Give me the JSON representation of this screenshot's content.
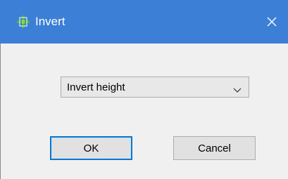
{
  "window": {
    "title": "Invert",
    "title_bar_color": "#3c7fd6",
    "icon": "app-plugin-icon"
  },
  "dropdown": {
    "selected": "Invert height",
    "icon": "chevron-down-icon"
  },
  "buttons": {
    "ok_label": "OK",
    "cancel_label": "Cancel"
  },
  "colors": {
    "accent": "#0078d7",
    "dialog_bg": "#f0f0f0"
  }
}
